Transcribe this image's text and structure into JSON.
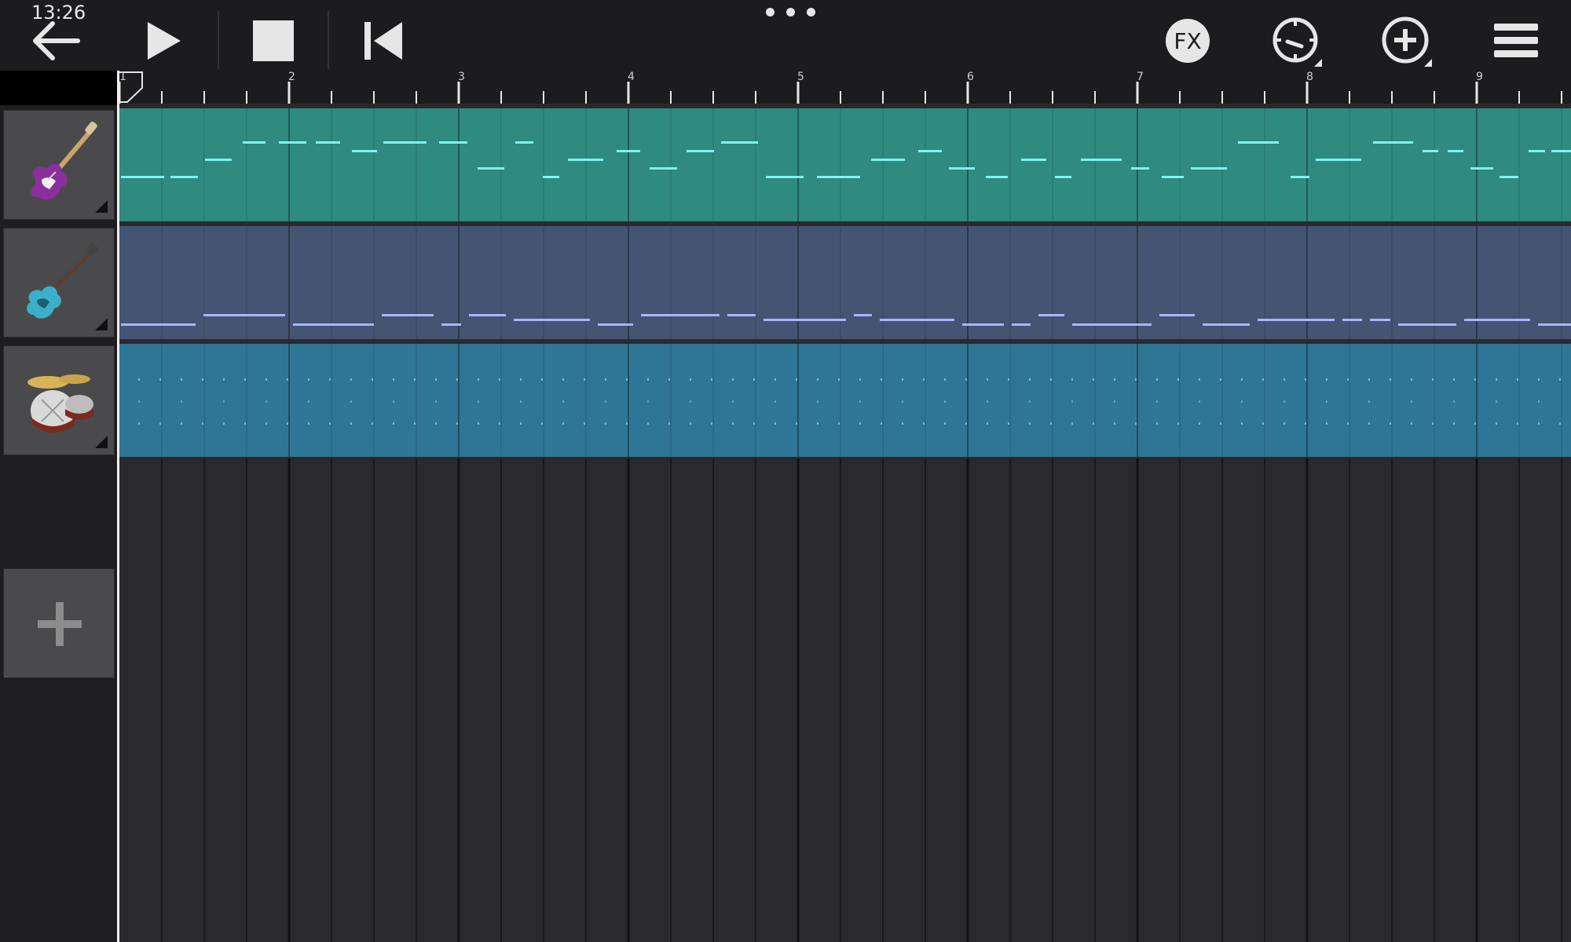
{
  "status_bar": {
    "time": "13:26"
  },
  "toolbar": {
    "back": {
      "icon": "arrow-left-icon"
    },
    "play": {
      "icon": "play-icon"
    },
    "stop": {
      "icon": "stop-icon"
    },
    "rewind": {
      "icon": "skip-to-start-icon"
    },
    "more": {
      "icon": "more-dots-icon"
    },
    "fx": {
      "icon": "fx-icon",
      "label": "FX"
    },
    "tempo": {
      "icon": "metronome-dial-icon"
    },
    "add": {
      "icon": "plus-circle-icon"
    },
    "menu": {
      "icon": "hamburger-menu-icon"
    }
  },
  "ruler": {
    "bars": [
      "1",
      "2",
      "3",
      "4",
      "5",
      "6",
      "7",
      "8",
      "9"
    ]
  },
  "tracks": [
    {
      "name": "electric-guitar",
      "icon": "electric-guitar-icon",
      "color": "#2f8a80",
      "note_color": "#7ff3f0"
    },
    {
      "name": "bass-guitar",
      "icon": "bass-guitar-icon",
      "color": "#435572",
      "note_color": "#a7b6ff"
    },
    {
      "name": "drums",
      "icon": "drum-kit-icon",
      "color": "#2f7596",
      "note_color": "#8fd8ea"
    }
  ],
  "add_track": {
    "icon": "plus-icon"
  }
}
